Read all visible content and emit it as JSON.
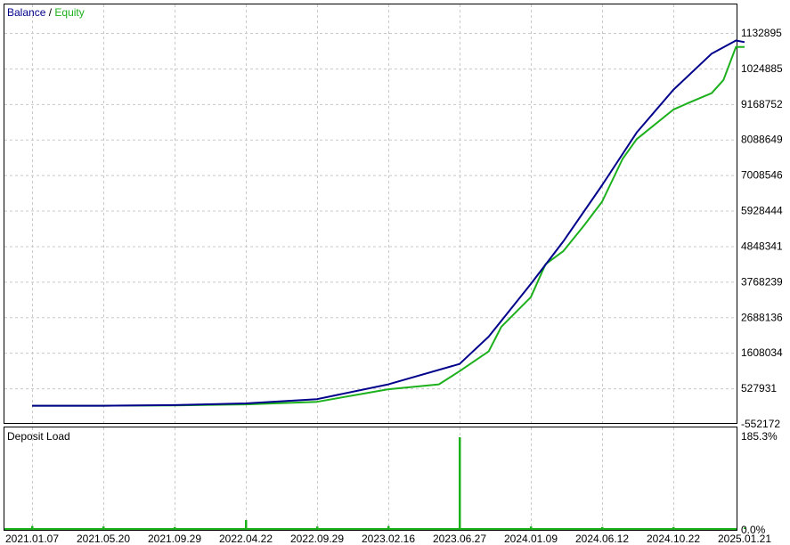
{
  "legend": {
    "balance": "Balance",
    "separator": "/",
    "equity": "Equity"
  },
  "subpanel": {
    "title": "Deposit Load",
    "top_label": "185.3%",
    "bottom_label": "0.0%"
  },
  "colors": {
    "balance": "#00008b",
    "equity": "#1cb01c",
    "load": "#1cb01c",
    "grid": "#c8c8c8",
    "frame": "#000000"
  },
  "chart_data": [
    {
      "type": "line",
      "title": "",
      "legend_placement": "top-left",
      "grid": true,
      "y_ticks": [
        "1132895",
        "1024885",
        "9168752",
        "8088649",
        "7008546",
        "5928444",
        "4848341",
        "3768239",
        "2688136",
        "1608034",
        "527931",
        "-552172"
      ],
      "ylim": [
        -552172,
        11328958
      ],
      "x_ticks": [
        "2021.01.07",
        "2021.05.20",
        "2021.09.29",
        "2022.04.22",
        "2022.09.29",
        "2023.02.16",
        "2023.06.27",
        "2024.01.09",
        "2024.06.12",
        "2024.10.22",
        "2025.01.21"
      ],
      "series": [
        {
          "name": "Balance",
          "x": [
            "2021.01.07",
            "2021.05.20",
            "2021.09.29",
            "2022.04.22",
            "2022.09.29",
            "2023.02.16",
            "2023.06.27",
            "2023.09.15",
            "2024.01.09",
            "2024.03.20",
            "2024.06.12",
            "2024.08.15",
            "2024.10.22",
            "2024.12.10",
            "2025.01.10",
            "2025.01.21"
          ],
          "values": [
            0,
            0,
            20000,
            70000,
            200000,
            650000,
            1270000,
            2100000,
            3700000,
            5000000,
            6700000,
            8300000,
            9600000,
            10700000,
            11100000,
            11050000
          ]
        },
        {
          "name": "Equity",
          "x": [
            "2021.01.07",
            "2021.05.20",
            "2021.09.29",
            "2022.04.22",
            "2022.09.29",
            "2023.02.16",
            "2023.05.20",
            "2023.06.27",
            "2023.09.15",
            "2023.10.20",
            "2024.01.09",
            "2024.02.10",
            "2024.03.20",
            "2024.05.05",
            "2024.06.12",
            "2024.07.20",
            "2024.08.15",
            "2024.10.22",
            "2024.11.10",
            "2024.12.10",
            "2024.12.25",
            "2025.01.10",
            "2025.01.21"
          ],
          "values": [
            0,
            0,
            10000,
            40000,
            120000,
            500000,
            650000,
            1050000,
            1650000,
            2400000,
            3300000,
            4300000,
            4700000,
            5500000,
            6200000,
            7500000,
            8100000,
            9000000,
            9200000,
            9500000,
            9900000,
            10900000,
            10900000
          ]
        }
      ]
    },
    {
      "type": "bar",
      "title": "Deposit Load",
      "ylim": [
        0,
        185.3
      ],
      "x": [
        "2021.01.07",
        "2021.05.20",
        "2021.09.29",
        "2022.04.22",
        "2022.09.29",
        "2023.02.16",
        "2023.06.27",
        "2024.01.09",
        "2024.06.12",
        "2024.10.22",
        "2025.01.21"
      ],
      "values": [
        6,
        5,
        4,
        18,
        5,
        6,
        185.3,
        5,
        4,
        4,
        3
      ]
    }
  ]
}
